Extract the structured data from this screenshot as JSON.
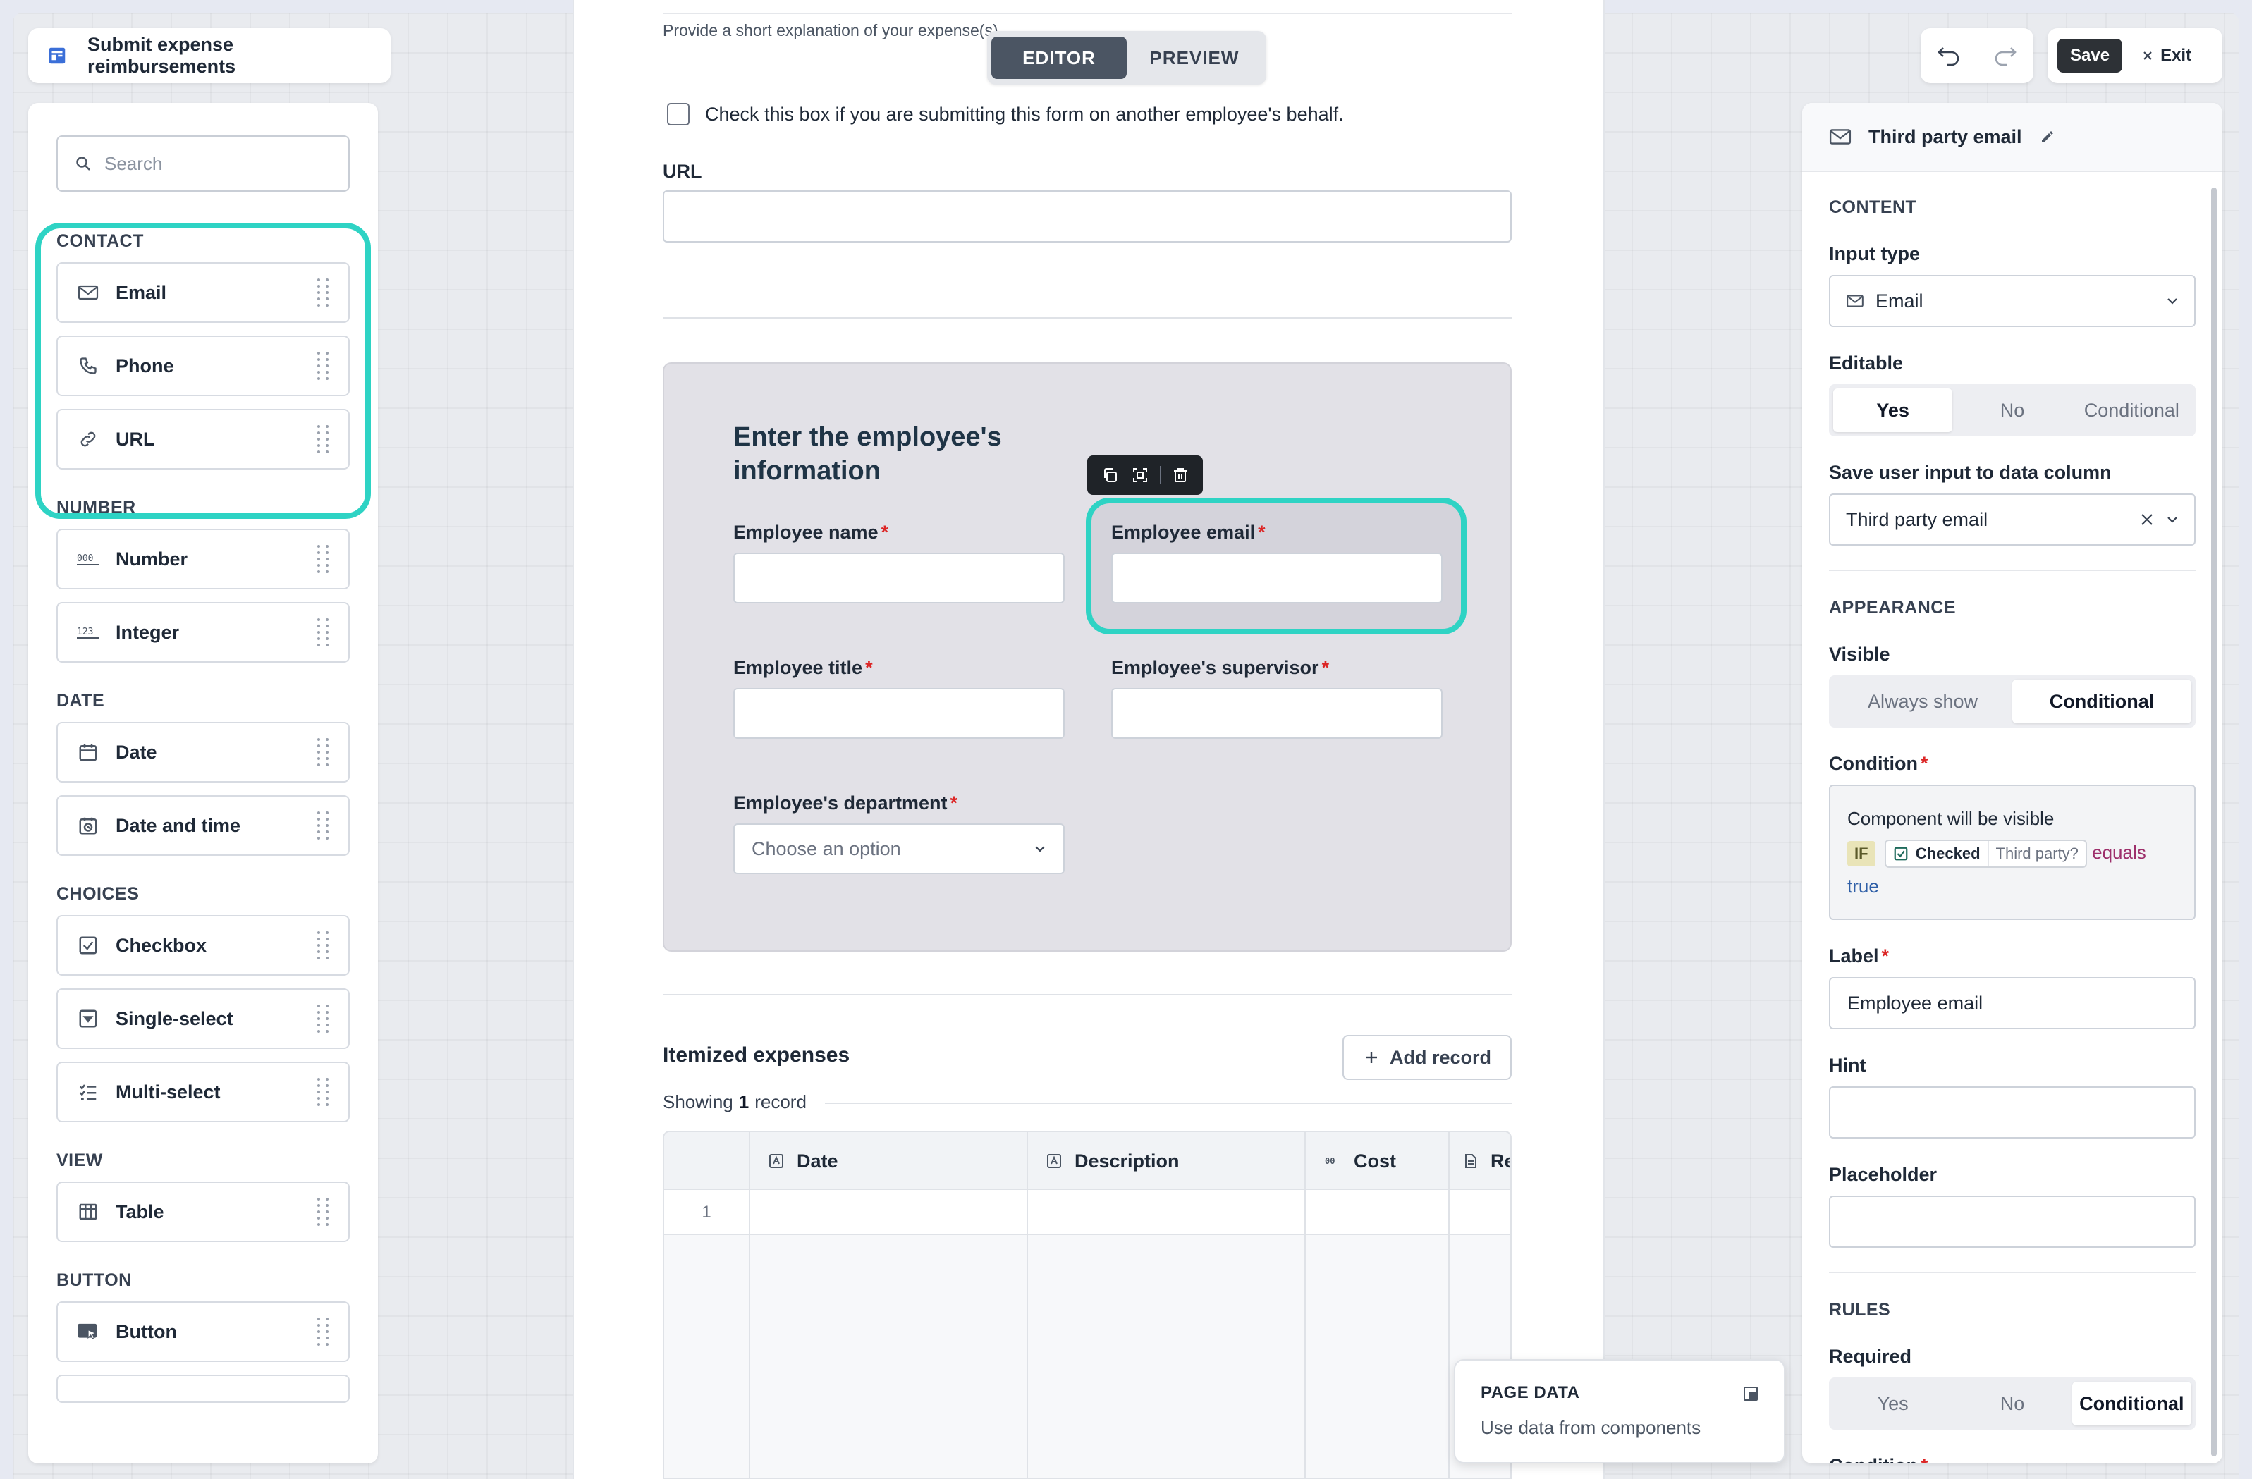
{
  "app": {
    "title": "Submit expense reimbursements"
  },
  "mode": {
    "editor": "EDITOR",
    "preview": "PREVIEW",
    "active": "editor"
  },
  "left": {
    "search_placeholder": "Search",
    "sections": {
      "contact": "CONTACT",
      "number": "NUMBER",
      "date": "DATE",
      "choices": "CHOICES",
      "view": "VIEW",
      "button": "BUTTON"
    },
    "items": {
      "email": "Email",
      "phone": "Phone",
      "url": "URL",
      "number": "Number",
      "integer": "Integer",
      "date": "Date",
      "datetime": "Date and time",
      "checkbox": "Checkbox",
      "single_select": "Single-select",
      "multi_select": "Multi-select",
      "table": "Table",
      "button": "Button"
    }
  },
  "canvas": {
    "hint_top": "Provide a short explanation of your expense(s)",
    "checkbox_label": "Check this box if you are submitting this form on another employee's behalf.",
    "url_label": "URL",
    "container_title": "Enter the employee's information",
    "fields": {
      "employee_name": "Employee name",
      "employee_email": "Employee email",
      "employee_title": "Employee title",
      "employee_supervisor": "Employee's supervisor",
      "employee_department": "Employee's department",
      "department_placeholder": "Choose an option",
      "required_mark": "*"
    },
    "itemized": {
      "title": "Itemized expenses",
      "add_record": "Add record",
      "showing_prefix": "Showing",
      "showing_count": "1",
      "showing_suffix": "record",
      "columns": [
        "Date",
        "Description",
        "Cost",
        "Re"
      ],
      "row_number": "1"
    },
    "page_data": {
      "title": "PAGE DATA",
      "subtitle": "Use data from components"
    }
  },
  "top_right": {
    "save": "Save",
    "exit": "Exit"
  },
  "right": {
    "header_title": "Third party email",
    "content_heading": "CONTENT",
    "input_type_label": "Input type",
    "input_type_value": "Email",
    "editable_label": "Editable",
    "editable_options": [
      "Yes",
      "No",
      "Conditional"
    ],
    "editable_selected": "Yes",
    "save_column_label": "Save user input to data column",
    "save_column_value": "Third party email",
    "appearance_heading": "APPEARANCE",
    "visible_label": "Visible",
    "visible_options": [
      "Always show",
      "Conditional"
    ],
    "visible_selected": "Conditional",
    "condition_label": "Condition",
    "condition_text": "Component will be visible",
    "condition_if": "IF",
    "condition_checked": "Checked",
    "condition_field": "Third party?",
    "condition_op": "equals",
    "condition_value": "true",
    "label_label": "Label",
    "label_value": "Employee email",
    "hint_label": "Hint",
    "placeholder_label": "Placeholder",
    "rules_heading": "RULES",
    "required_label": "Required",
    "required_options": [
      "Yes",
      "No",
      "Conditional"
    ],
    "required_selected": "Conditional",
    "condition2_label": "Condition",
    "required_mark": "*"
  },
  "colors": {
    "highlight": "#2ed3c4",
    "dark_button": "#2d3136",
    "required": "#dc2626"
  }
}
